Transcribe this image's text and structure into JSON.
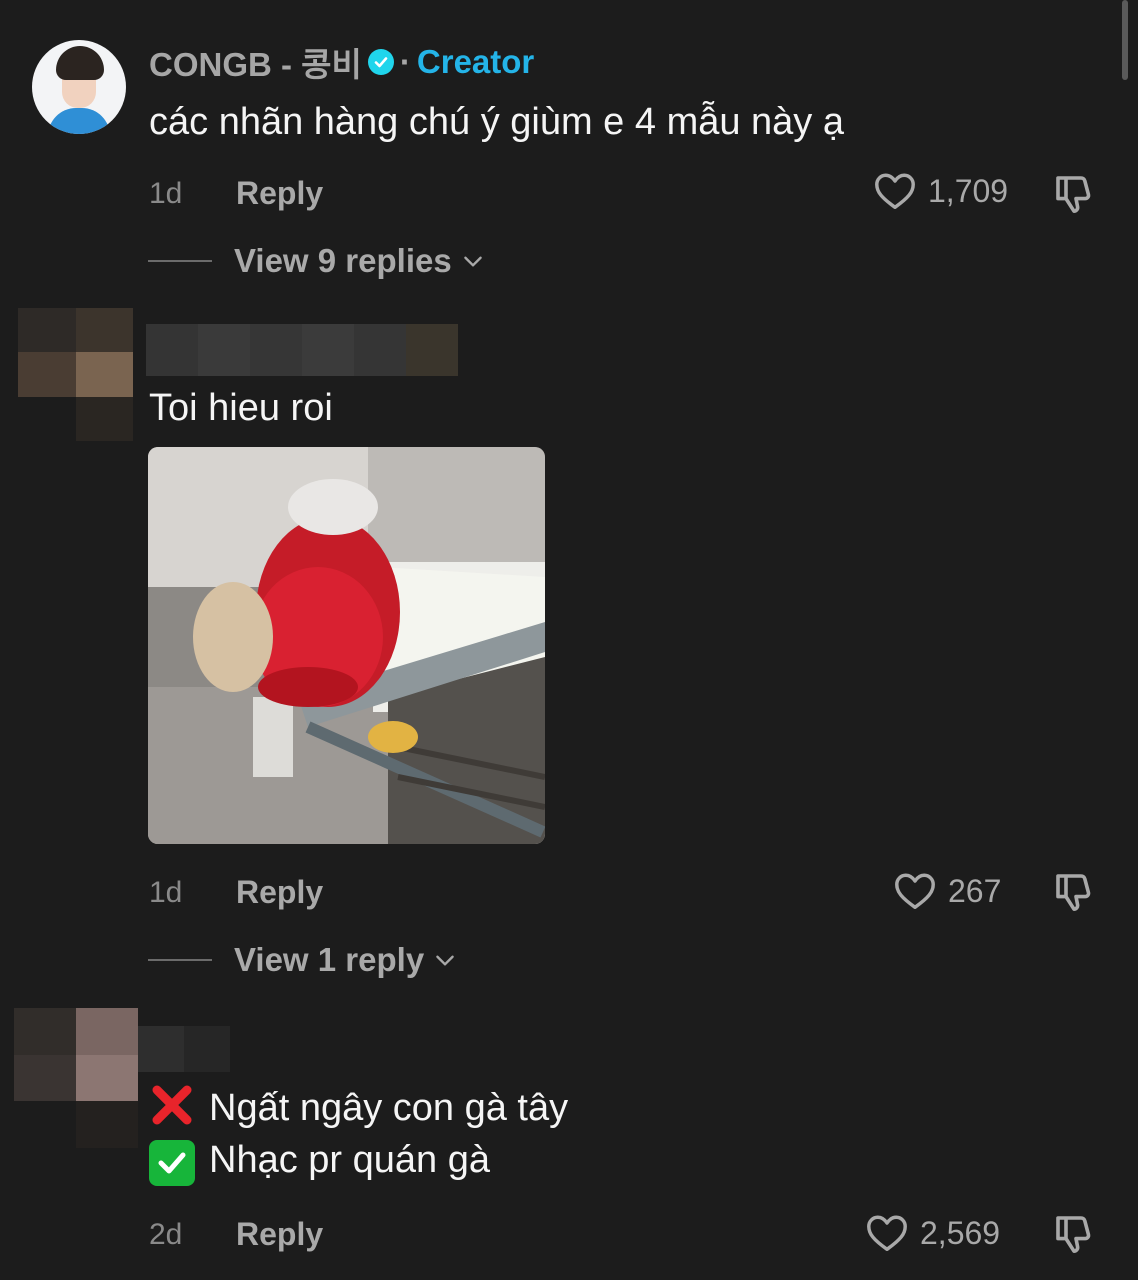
{
  "comments": [
    {
      "username": "CONGB - 콩비",
      "creator_tag": "Creator",
      "separator": "·",
      "text": "các nhãn hàng chú ý giùm e 4 mẫu này ạ",
      "time": "1d",
      "reply_label": "Reply",
      "likes": "1,709",
      "view_replies": "View 9 replies"
    },
    {
      "text": "Toi hieu roi",
      "time": "1d",
      "reply_label": "Reply",
      "likes": "267",
      "view_replies": "View 1 reply"
    },
    {
      "lines": [
        "Ngất ngây con gà tây",
        "Nhạc pr quán gà"
      ],
      "line_icons": [
        "cross-mark",
        "check-mark"
      ],
      "time": "2d",
      "reply_label": "Reply",
      "likes": "2,569"
    }
  ],
  "colors": {
    "background": "#1c1c1c",
    "creator": "#24b4e8",
    "verified": "#20d5ec",
    "muted": "#a9a9a9",
    "cross": "#e8242b",
    "check": "#17b53a"
  }
}
